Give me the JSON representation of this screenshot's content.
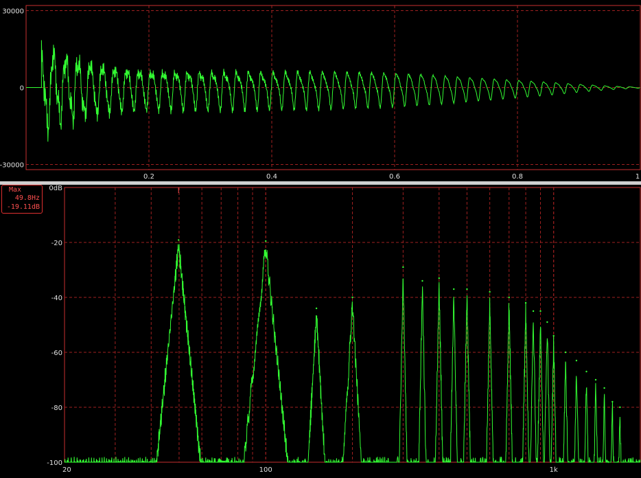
{
  "waveform": {
    "y_ticks": [
      "30000",
      "0",
      "-30000"
    ],
    "x_ticks": [
      "0.2",
      "0.4",
      "0.6",
      "0.8",
      "1"
    ],
    "colors": {
      "trace": "#33ff33",
      "grid": "#a02020",
      "frame": "#c83030",
      "background": "#000000"
    }
  },
  "spectrum": {
    "y_ticks": [
      "0dB",
      "-20",
      "-40",
      "-60",
      "-80",
      "-100"
    ],
    "x_ticks": [
      "20",
      "100",
      "1k"
    ],
    "marker": {
      "title": "Max",
      "frequency": "49.8Hz",
      "level": "-19.11dB"
    },
    "colors": {
      "trace": "#33ff33",
      "grid": "#a02020",
      "marker": "#ff5050"
    }
  },
  "chart_data": [
    {
      "type": "line",
      "xlim": [
        0,
        1
      ],
      "ylim": [
        -32000,
        32000
      ],
      "grid": true,
      "series": [
        {
          "x": [
            0,
            0.03,
            0.05,
            0.1,
            0.15,
            0.2,
            0.3,
            0.4,
            0.5,
            0.6,
            0.65,
            0.7,
            0.75,
            0.8,
            0.85,
            0.9,
            0.95,
            1.0
          ],
          "y": [
            0,
            20000,
            16000,
            13000,
            10500,
            9000,
            8500,
            8000,
            8000,
            7500,
            7000,
            6000,
            5000,
            4000,
            3000,
            1800,
            800,
            200
          ]
        }
      ]
    },
    {
      "type": "line",
      "xscale": "log",
      "xlim": [
        20,
        2000
      ],
      "ylim": [
        -100,
        0
      ],
      "grid": true,
      "series": [
        {
          "x": [
            49.8,
            100,
            150,
            200,
            300,
            350,
            400,
            450,
            500,
            600,
            700,
            800,
            850,
            900,
            950,
            1000,
            1100,
            1200,
            1300,
            1400,
            1500,
            1600,
            1700
          ],
          "y": [
            -19.11,
            -19.5,
            -44,
            -40,
            -29,
            -34,
            -33,
            -37,
            -37,
            -38,
            -40,
            -42,
            -45,
            -45,
            -49,
            -54,
            -60,
            -63,
            -67,
            -70,
            -73,
            -78,
            -80
          ]
        }
      ]
    }
  ]
}
